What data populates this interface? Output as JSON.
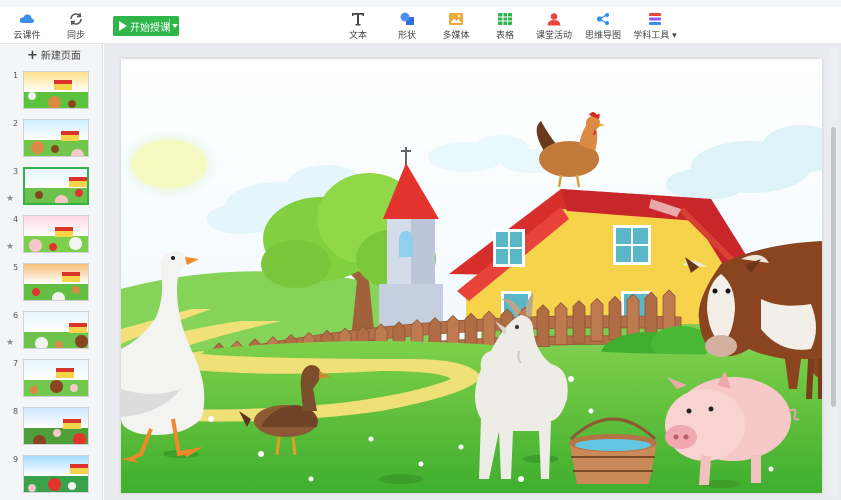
{
  "toolbar": {
    "cloud_label": "云课件",
    "sync_label": "同步",
    "start_label": "开始授课",
    "tools": [
      {
        "label": "文本",
        "icon": "text-icon"
      },
      {
        "label": "形状",
        "icon": "shape-icon"
      },
      {
        "label": "多媒体",
        "icon": "media-icon"
      },
      {
        "label": "表格",
        "icon": "table-icon"
      },
      {
        "label": "课堂活动",
        "icon": "activity-icon"
      },
      {
        "label": "思维导图",
        "icon": "mindmap-icon"
      },
      {
        "label": "学科工具 ▾",
        "icon": "subject-tools-icon"
      }
    ]
  },
  "sidebar": {
    "new_page_label": "新建页面",
    "pages": [
      {
        "num": "1",
        "starred": false,
        "active": false
      },
      {
        "num": "2",
        "starred": false,
        "active": false
      },
      {
        "num": "3",
        "starred": true,
        "active": true
      },
      {
        "num": "4",
        "starred": true,
        "active": false
      },
      {
        "num": "5",
        "starred": false,
        "active": false
      },
      {
        "num": "6",
        "starred": true,
        "active": false
      },
      {
        "num": "7",
        "starred": false,
        "active": false
      },
      {
        "num": "8",
        "starred": false,
        "active": false
      },
      {
        "num": "9",
        "starred": false,
        "active": false
      }
    ]
  },
  "colors": {
    "accent_green": "#2fb54a",
    "barn_red": "#d9342b",
    "barn_yellow": "#f7d34c",
    "grass": "#5cc43c"
  }
}
